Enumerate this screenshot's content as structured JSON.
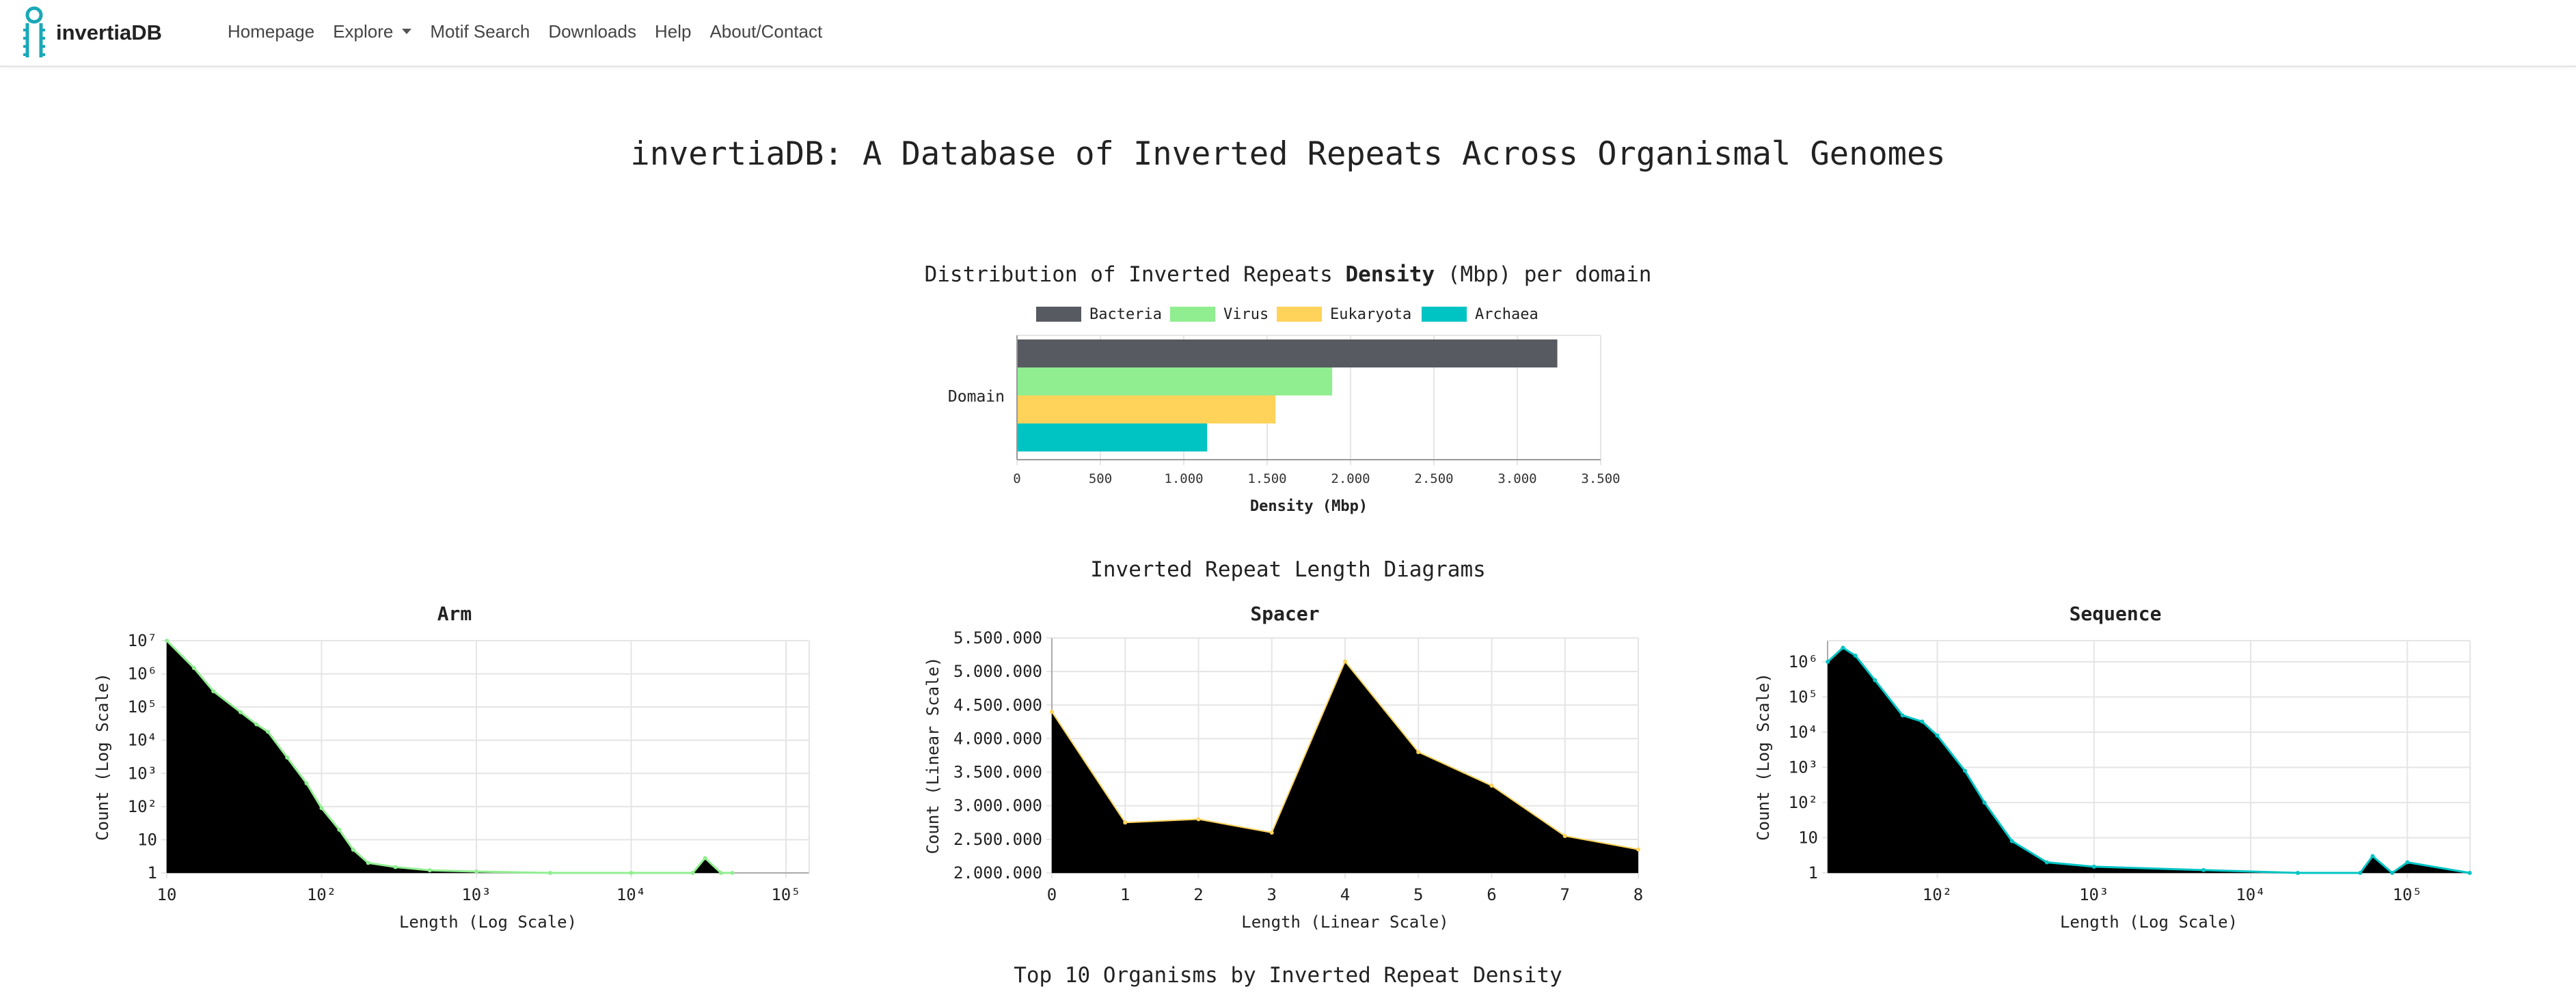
{
  "navbar": {
    "brand": "invertiaDB",
    "links": [
      "Homepage",
      "Explore",
      "Motif Search",
      "Downloads",
      "Help",
      "About/Contact"
    ]
  },
  "page_title": "invertiaDB: A Database of Inverted Repeats Across Organismal Genomes",
  "bar_chart": {
    "title_pre": "Distribution of Inverted Repeats ",
    "title_bold": "Density",
    "title_post": " (Mbp) per domain"
  },
  "length_section": {
    "title": "Inverted Repeat Length Diagrams"
  },
  "top_section": {
    "title": "Top 10 Organisms by Inverted Repeat Density"
  },
  "colors": {
    "bacteria": "#575a60",
    "virus": "#90ee90",
    "eukaryota": "#ffd25a",
    "archaea": "#00c4c4"
  },
  "chart_data": [
    {
      "type": "bar",
      "orientation": "horizontal",
      "category_label": "Domain",
      "series": [
        {
          "name": "Bacteria",
          "values": [
            3240
          ]
        },
        {
          "name": "Virus",
          "values": [
            1890
          ]
        },
        {
          "name": "Eukaryota",
          "values": [
            1550
          ]
        },
        {
          "name": "Archaea",
          "values": [
            1140
          ]
        }
      ],
      "xlabel": "Density (Mbp)",
      "xticks": [
        "0",
        "500",
        "1.000",
        "1.500",
        "2.000",
        "2.500",
        "3.000",
        "3.500"
      ],
      "xlim": [
        0,
        3500
      ],
      "legend": "top",
      "grid": true
    },
    {
      "type": "area",
      "title": "Arm",
      "xscale": "log",
      "yscale": "log",
      "xlabel": "Length (Log Scale)",
      "ylabel": "Count (Log Scale)",
      "xticks": [
        "10",
        "10²",
        "10³",
        "10⁴",
        "10⁵"
      ],
      "yticks": [
        "1",
        "10",
        "10²",
        "10³",
        "10⁴",
        "10⁵",
        "10⁶",
        "10⁷"
      ],
      "x": [
        10,
        15,
        20,
        30,
        38,
        45,
        60,
        80,
        100,
        130,
        160,
        200,
        300,
        500,
        1000,
        3000,
        10000,
        25000,
        30000,
        38000,
        45000
      ],
      "y": [
        10000000,
        1500000,
        300000,
        70000,
        30000,
        18000,
        3000,
        500,
        90,
        20,
        5,
        2,
        1.5,
        1.2,
        1.1,
        1,
        1,
        1,
        2.8,
        1,
        1
      ],
      "grid": true
    },
    {
      "type": "area",
      "title": "Spacer",
      "xscale": "linear",
      "yscale": "linear",
      "xlabel": "Length (Linear Scale)",
      "ylabel": "Count (Linear Scale)",
      "xticks": [
        "0",
        "1",
        "2",
        "3",
        "4",
        "5",
        "6",
        "7",
        "8"
      ],
      "yticks": [
        "2.000.000",
        "2.500.000",
        "3.000.000",
        "3.500.000",
        "4.000.000",
        "4.500.000",
        "5.000.000",
        "5.500.000"
      ],
      "x": [
        0,
        1,
        2,
        3,
        4,
        5,
        6,
        7,
        8
      ],
      "y": [
        4400000,
        2750000,
        2800000,
        2600000,
        5150000,
        3800000,
        3300000,
        2550000,
        2350000
      ],
      "ylim": [
        2000000,
        5500000
      ],
      "grid": true
    },
    {
      "type": "area",
      "title": "Sequence",
      "xscale": "log",
      "yscale": "log",
      "xlabel": "Length (Log Scale)",
      "ylabel": "Count (Log Scale)",
      "xticks": [
        "10²",
        "10³",
        "10⁴",
        "10⁵"
      ],
      "yticks": [
        "1",
        "10",
        "10²",
        "10³",
        "10⁴",
        "10⁵",
        "10⁶"
      ],
      "x": [
        20,
        25,
        30,
        40,
        60,
        80,
        100,
        150,
        200,
        300,
        500,
        1000,
        5000,
        20000,
        50000,
        60000,
        80000,
        100000,
        250000
      ],
      "y": [
        1000000,
        2500000,
        1500000,
        300000,
        30000,
        20000,
        8000,
        800,
        100,
        8,
        2,
        1.5,
        1.2,
        1,
        1,
        3,
        1,
        2,
        1
      ],
      "grid": true
    }
  ]
}
